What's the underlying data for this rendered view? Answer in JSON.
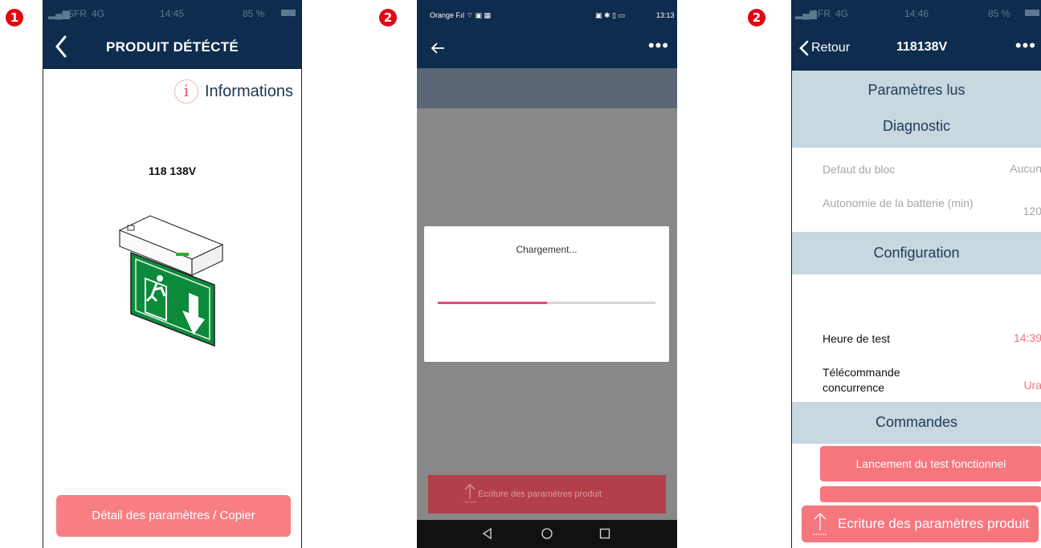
{
  "badges": [
    "1",
    "2",
    "2"
  ],
  "screen1": {
    "status": {
      "carrier": "SFR",
      "network": "4G",
      "time": "14:45",
      "battery": "85 %"
    },
    "title": "PRODUIT DÉTÉCTÉ",
    "info_label": "Informations",
    "product_code": "118 138V",
    "detail_button": "Détail des paramètres / Copier"
  },
  "screen2": {
    "status": {
      "carrier": "Orange F",
      "time": "13:13"
    },
    "loading_text": "Chargement...",
    "progress": 0.5,
    "write_button": "Ecriture des paramètres produit"
  },
  "screen3": {
    "status": {
      "carrier": "SFR",
      "network": "4G",
      "time": "14:46",
      "battery": "85 %"
    },
    "back_label": "Retour",
    "title": "118138V",
    "sections": {
      "params": "Paramètres lus",
      "diagnostic": "Diagnostic",
      "config": "Configuration",
      "commands": "Commandes"
    },
    "rows": {
      "defaut_label": "Defaut du bloc",
      "defaut_value": "Aucun",
      "autonomie_label": "Autonomie de la batterie (min)",
      "autonomie_value": "120",
      "heure_label": "Heure de test",
      "heure_value": "14:39",
      "telecommande_label": "Télécommande concurrence",
      "telecommande_value": "Ura"
    },
    "cmd_button": "Lancement du test fonctionnel",
    "write_button": "Ecriture des paramètres produit"
  },
  "colors": {
    "nav": "#0e2d4e",
    "accent": "#f6767e",
    "section": "#c8d7e0",
    "badge": "#e30613",
    "progress": "#f0457c"
  }
}
